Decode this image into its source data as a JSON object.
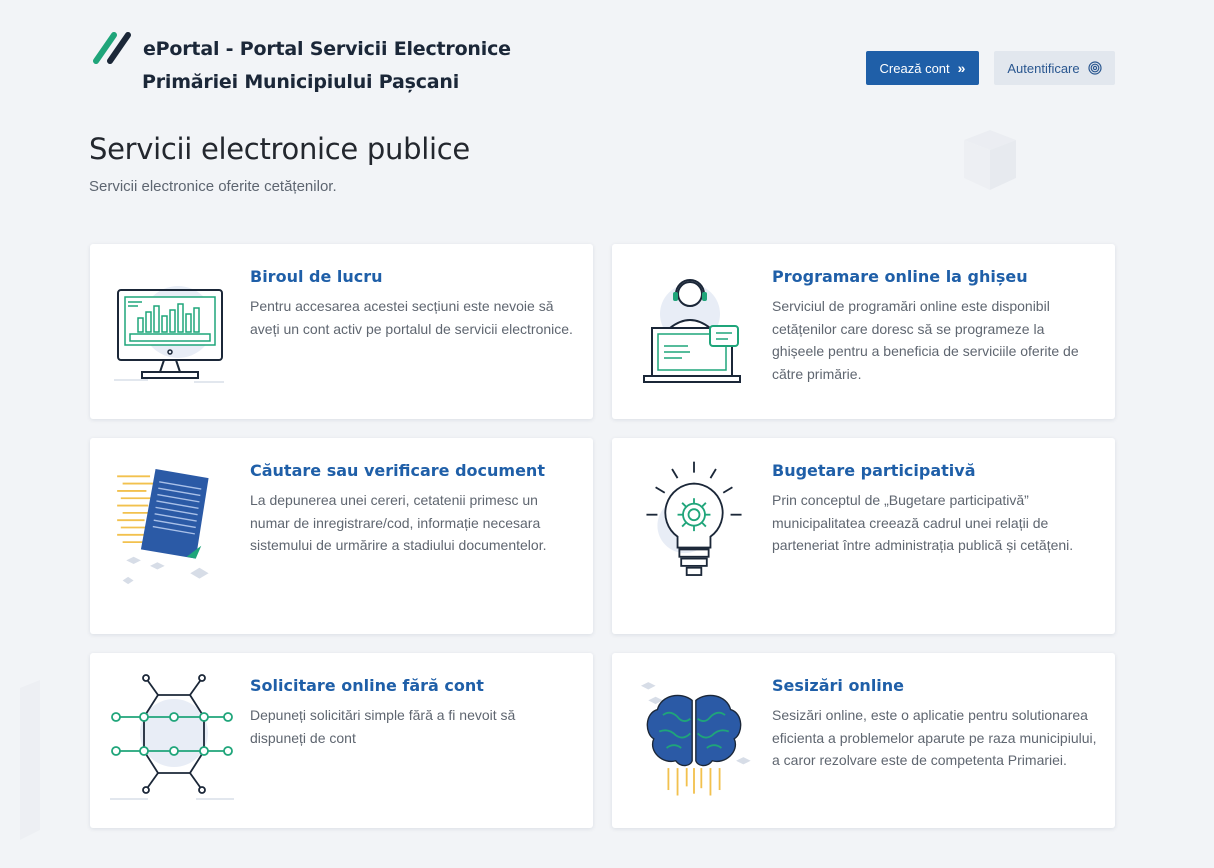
{
  "header": {
    "logo_line1": "ePortal - Portal Servicii Electronice",
    "logo_line2": "Primăriei Municipiului Pașcani",
    "create_account_label": "Crează cont",
    "create_account_icon": "double-chevron-right-icon",
    "login_label": "Autentificare",
    "login_icon": "fingerprint-icon"
  },
  "page": {
    "title": "Servicii electronice publice",
    "subtitle": "Servicii electronice oferite cetățenilor."
  },
  "cards": [
    {
      "title": "Biroul de lucru",
      "description": "Pentru accesarea acestei secțiuni este nevoie să aveți un cont activ pe portalul de servicii electronice.",
      "icon": "desktop-chart-icon"
    },
    {
      "title": "Programare online la ghișeu",
      "description": "Serviciul de programări online este disponibil cetățenilor care doresc să se programeze la ghișeele pentru a beneficia de serviciile oferite de către primărie.",
      "icon": "support-agent-laptop-icon"
    },
    {
      "title": "Căutare sau verificare document",
      "description": "La depunerea unei cereri, cetatenii primesc un numar de inregistrare/cod, informație necesara sistemului de urmărire a stadiului documentelor.",
      "icon": "document-icon"
    },
    {
      "title": "Bugetare participativă",
      "description": "Prin conceptul de „Bugetare participativă” municipalitatea creează cadrul unei relații de parteneriat între administrația publică și cetățeni.",
      "icon": "lightbulb-gear-icon"
    },
    {
      "title": "Solicitare online fără cont",
      "description": "Depuneți solicitări simple fără a fi nevoit să dispuneți de cont",
      "icon": "network-nodes-icon"
    },
    {
      "title": "Sesizări online",
      "description": "Sesizări online, este o aplicatie pentru solutionarea eficienta a problemelor aparute pe raza municipiului, a caror rezolvare este de competenta Primariei.",
      "icon": "brain-icon"
    }
  ],
  "colors": {
    "brand_blue": "#1f5fa8",
    "accent_green": "#1fa57a",
    "background": "#f2f4f7"
  }
}
